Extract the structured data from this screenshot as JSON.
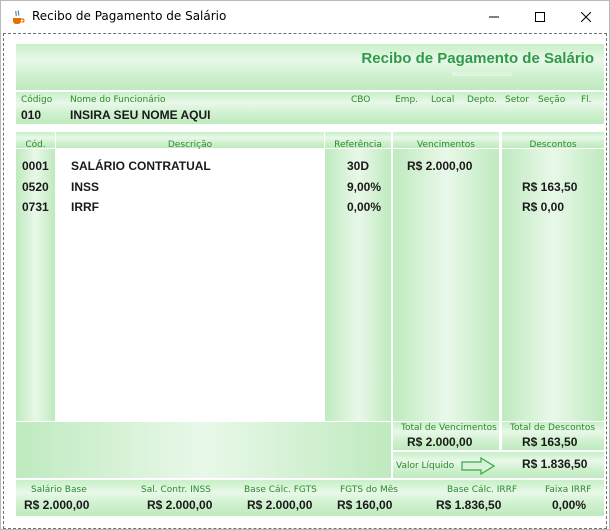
{
  "window": {
    "title": "Recibo de Pagamento de Salário"
  },
  "colors": {
    "accent_green": "#2e9a4a",
    "label_green": "#2e8b2e",
    "panel_light": "#e9f8e9",
    "panel_dark": "#bfeabf"
  },
  "header": {
    "title": "Recibo de Pagamento de Salário"
  },
  "employee": {
    "labels": {
      "codigo": "Código",
      "nome": "Nome do Funcionário",
      "cbo": "CBO",
      "emp": "Emp.",
      "local": "Local",
      "depto": "Depto.",
      "setor": "Setor",
      "secao": "Seção",
      "fl": "Fl."
    },
    "codigo": "010",
    "nome": "INSIRA SEU NOME AQUI"
  },
  "table": {
    "headers": {
      "cod": "Cód.",
      "descricao": "Descrição",
      "referencia": "Referência",
      "vencimentos": "Vencimentos",
      "descontos": "Descontos"
    },
    "rows": [
      {
        "cod": "0001",
        "descricao": "SALÁRIO CONTRATUAL",
        "referencia": "30D",
        "vencimento": "R$ 2.000,00",
        "desconto": ""
      },
      {
        "cod": "0520",
        "descricao": "INSS",
        "referencia": "9,00%",
        "vencimento": "",
        "desconto": "R$ 163,50"
      },
      {
        "cod": "0731",
        "descricao": "IRRF",
        "referencia": "0,00%",
        "vencimento": "",
        "desconto": "R$ 0,00"
      }
    ]
  },
  "totals": {
    "vencimentos_label": "Total de Vencimentos",
    "vencimentos": "R$ 2.000,00",
    "descontos_label": "Total de Descontos",
    "descontos": "R$ 163,50",
    "liquido_label": "Valor Líquido",
    "liquido": "R$ 1.836,50",
    "arrow_icon": "arrow-right-icon"
  },
  "footer": {
    "salario_base_label": "Salário Base",
    "salario_base": "R$ 2.000,00",
    "sal_contr_inss_label": "Sal. Contr. INSS",
    "sal_contr_inss": "R$ 2.000,00",
    "base_fgts_label": "Base Cálc. FGTS",
    "base_fgts": "R$ 2.000,00",
    "fgts_mes_label": "FGTS do Mês",
    "fgts_mes": "R$ 160,00",
    "base_irrf_label": "Base Cálc. IRRF",
    "base_irrf": "R$ 1.836,50",
    "faixa_irrf_label": "Faixa IRRF",
    "faixa_irrf": "0,00%"
  }
}
